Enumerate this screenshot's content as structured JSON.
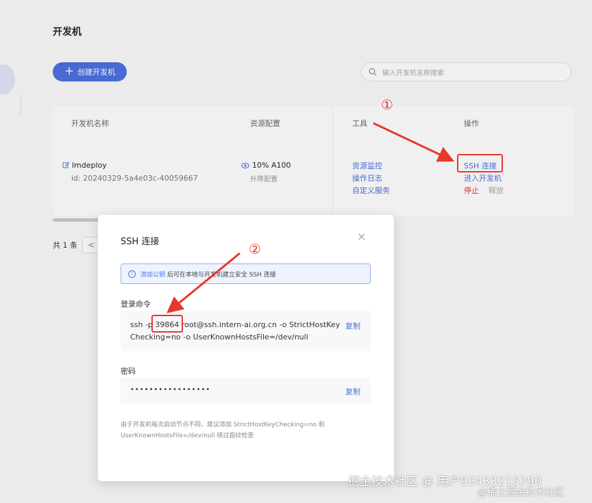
{
  "page": {
    "title": "开发机",
    "create_button": "创建开发机",
    "search_placeholder": "输入开发机名称搜索"
  },
  "table": {
    "headers": {
      "name": "开发机名称",
      "resource": "资源配置",
      "tools": "工具",
      "actions": "操作"
    },
    "row": {
      "name": "lmdeploy",
      "id": "id: 20240329-5a4e03c-40059667",
      "resource": "10% A100",
      "resource_sub": "升降配置",
      "tools": [
        "资源监控",
        "操作日志",
        "自定义服务"
      ],
      "actions": {
        "ssh": "SSH 连接",
        "enter": "进入开发机",
        "stop": "停止",
        "release": "释放"
      }
    }
  },
  "pagination": {
    "total": "共 1 条",
    "prev": "<"
  },
  "annotations": {
    "step1": "①",
    "step2": "②",
    "color": "#e8372b"
  },
  "modal": {
    "title": "SSH 连接",
    "close": "×",
    "alert_link": "添加公钥",
    "alert_text": "后可在本地与开发机建立安全 SSH 连接",
    "login_label": "登录命令",
    "command_line1": "ssh -p 39864 root@ssh.intern-ai.org.cn -o StrictHostKey",
    "command_line2": "Checking=no -o UserKnownHostsFile=/dev/null",
    "copy_label": "复制",
    "password_label": "密码",
    "password": "•••••••••••••••••",
    "note_line1": "由于开发机每次启动节点不同，建议添加 StrictHostKeyChecking=no 和",
    "note_line2": "UserKnownHostsFile=/dev/null 绕过指纹检查"
  },
  "watermark": {
    "line1": "掘金技术社区 @ 用户92433215790",
    "line2": "@稀土掘金技术社区"
  },
  "colors": {
    "accent": "#4a6fe0",
    "danger": "#e8372b"
  }
}
